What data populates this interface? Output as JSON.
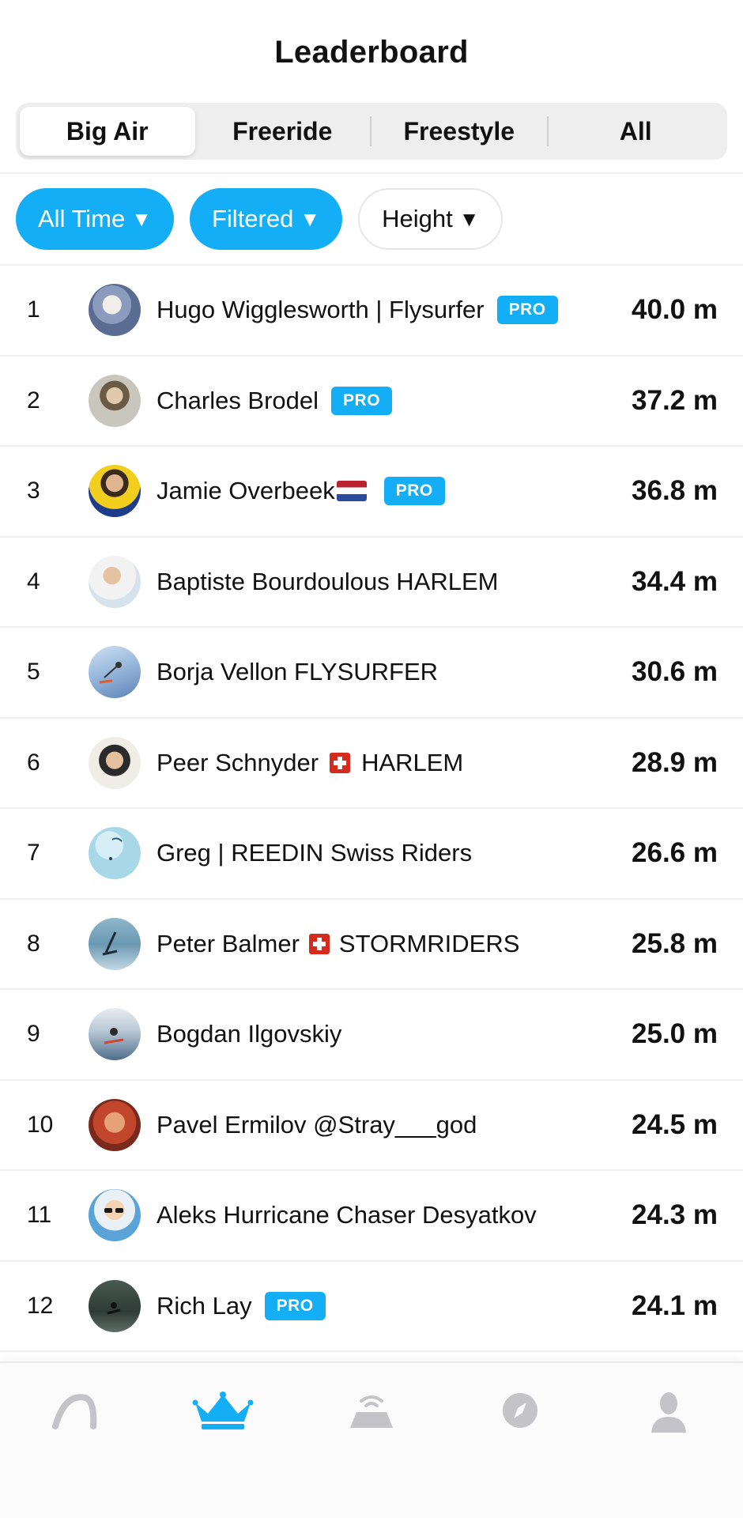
{
  "header": {
    "title": "Leaderboard"
  },
  "segments": [
    {
      "label": "Big Air",
      "active": true
    },
    {
      "label": "Freeride",
      "active": false
    },
    {
      "label": "Freestyle",
      "active": false
    },
    {
      "label": "All",
      "active": false
    }
  ],
  "filters": {
    "time": "All Time",
    "mode": "Filtered",
    "metric": "Height",
    "caret": "▼"
  },
  "badge_label": "PRO",
  "rows": [
    {
      "rank": "1",
      "name": "Hugo Wigglesworth | Flysurfer",
      "value": "40.0 m",
      "pro": true
    },
    {
      "rank": "2",
      "name": "Charles Brodel",
      "value": "37.2 m",
      "pro": true
    },
    {
      "rank": "3",
      "name": "Jamie Overbeek",
      "flag": "nl",
      "value": "36.8 m",
      "pro": true
    },
    {
      "rank": "4",
      "name": "Baptiste Bourdoulous HARLEM",
      "value": "34.4 m",
      "pro": false
    },
    {
      "rank": "5",
      "name": "Borja Vellon FLYSURFER",
      "value": "30.6 m",
      "pro": false
    },
    {
      "rank": "6",
      "name": "Peer Schnyder",
      "flag": "ch",
      "name_suffix": "HARLEM",
      "value": "28.9 m",
      "pro": false
    },
    {
      "rank": "7",
      "name": "Greg | REEDIN Swiss Riders",
      "value": "26.6 m",
      "pro": false
    },
    {
      "rank": "8",
      "name": "Peter Balmer",
      "flag": "ch",
      "name_suffix": "STORMRIDERS",
      "value": "25.8 m",
      "pro": false
    },
    {
      "rank": "9",
      "name": "Bogdan Ilgovskiy",
      "value": "25.0 m",
      "pro": false
    },
    {
      "rank": "10",
      "name": "Pavel Ermilov @Stray___god",
      "value": "24.5 m",
      "pro": false
    },
    {
      "rank": "11",
      "name": "Aleks Hurricane Chaser Desyatkov",
      "value": "24.3 m",
      "pro": false
    },
    {
      "rank": "12",
      "name": "Rich Lay",
      "value": "24.1 m",
      "pro": true
    }
  ],
  "tabbar": {
    "items": [
      {
        "icon": "kite-icon",
        "active": false
      },
      {
        "icon": "crown-icon",
        "active": true
      },
      {
        "icon": "device-signal-icon",
        "active": false
      },
      {
        "icon": "compass-icon",
        "active": false
      },
      {
        "icon": "profile-icon",
        "active": false
      }
    ],
    "active_color": "#13aef5",
    "inactive_color": "#c4c4c8"
  },
  "colors": {
    "accent": "#13aef5"
  }
}
